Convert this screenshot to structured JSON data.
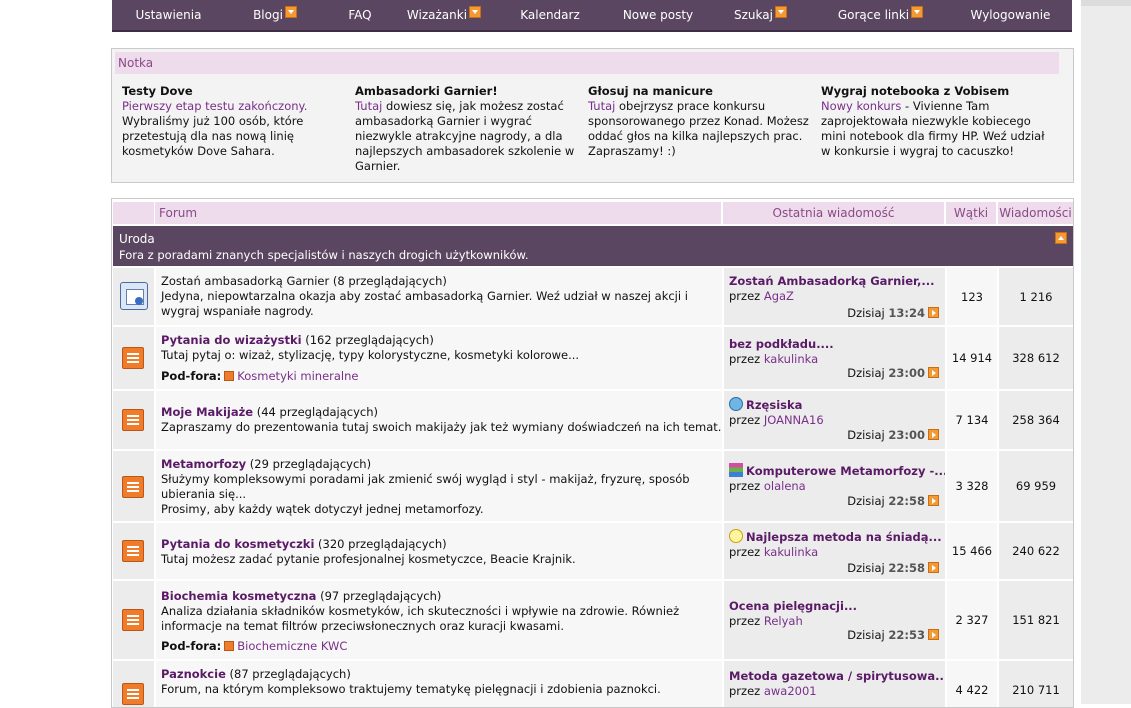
{
  "nav": [
    {
      "label": "Ustawienia",
      "dropdown": false
    },
    {
      "label": "Blogi",
      "dropdown": true
    },
    {
      "label": "FAQ",
      "dropdown": false
    },
    {
      "label": "Wizażanki",
      "dropdown": true
    },
    {
      "label": "Kalendarz",
      "dropdown": false
    },
    {
      "label": "Nowe posty",
      "dropdown": false
    },
    {
      "label": "Szukaj",
      "dropdown": true
    },
    {
      "label": "Gorące linki",
      "dropdown": true
    },
    {
      "label": "Wylogowanie",
      "dropdown": false
    }
  ],
  "notice": {
    "header": "Notka",
    "columns": [
      {
        "title": "Testy Dove",
        "link": "Pierwszy etap testu zakończony.",
        "text": " Wybraliśmy już 100 osób, które przetestują dla nas nową linię kosmetyków Dove Sahara."
      },
      {
        "title": "Ambasadorki Garnier!",
        "link": "Tutaj",
        "text": " dowiesz się, jak możesz zostać ambasadorką Garnier i wygrać niezwykle atrakcyjne nagrody, a dla najlepszych ambasadorek szkolenie w Garnier."
      },
      {
        "title": "Głosuj na manicure",
        "link": "Tutaj",
        "text": " obejrzysz prace konkursu sponsorowanego przez Konad. Możesz oddać głos na kilka najlepszych prac. Zapraszamy! :)"
      },
      {
        "title": "Wygraj notebooka z Vobisem",
        "link": "Nowy konkurs",
        "text": " - Vivienne Tam zaprojektowała niezwykle kobiecego mini notebook dla firmy HP. Weź udział w konkursie i wygraj to cacuszko!"
      }
    ]
  },
  "table": {
    "headers": {
      "forum": "Forum",
      "last": "Ostatnia wiadomość",
      "threads": "Wątki",
      "posts": "Wiadomości"
    },
    "category": {
      "name": "Uroda",
      "description": "Fora z poradami znanych specjalistów i naszych drogich użytkowników."
    },
    "rows": [
      {
        "title": "Zostań ambasadorką Garnier",
        "viewers": " (8 przeglądających)",
        "desc": "Jedyna, niepowtarzalna okazja aby zostać ambasadorką Garnier. Weź udział w naszej akcji i wygraj wspaniałe nagrody.",
        "subforum_label": "",
        "subforum": "",
        "last_title": "Zostań Ambasadorką Garnier,...",
        "last_icon": "",
        "last_by": "przez ",
        "last_user": "AgaZ",
        "last_day": "Dzisiaj ",
        "last_time": "13:24",
        "threads": "123",
        "posts": "1 216",
        "icon": "special-forum-icon"
      },
      {
        "title": "Pytania do wizażystki",
        "viewers": " (162 przeglądających)",
        "desc": "Tutaj pytaj o: wizaż, stylizację, typy kolorystyczne, kosmetyki kolorowe...",
        "subforum_label": "Pod-fora:",
        "subforum": "Kosmetyki mineralne",
        "last_title": "bez podkładu....",
        "last_icon": "",
        "last_by": "przez ",
        "last_user": "kakulinka",
        "last_day": "Dzisiaj ",
        "last_time": "23:00",
        "threads": "14 914",
        "posts": "328 612",
        "icon": "forum-icon"
      },
      {
        "title": "Moje Makijaże",
        "viewers": " (44 przeglądających)",
        "desc": "Zapraszamy do prezentowania tutaj swoich makijaży jak też wymiany doświadczeń na ich temat.",
        "subforum_label": "",
        "subforum": "",
        "last_title": "Rzęsiska",
        "last_icon": "smile",
        "last_by": "przez ",
        "last_user": "JOANNA16",
        "last_day": "Dzisiaj ",
        "last_time": "23:00",
        "threads": "7 134",
        "posts": "258 364",
        "icon": "forum-icon"
      },
      {
        "title": "Metamorfozy",
        "viewers": " (29 przeglądających)",
        "desc": "Służymy kompleksowymi poradami jak zmienić swój wygląd i styl - makijaż, fryzurę, sposób ubierania się...",
        "desc2": "Prosimy, aby każdy wątek dotyczył jednej metamorfozy.",
        "subforum_label": "",
        "subforum": "",
        "last_title": "Komputerowe Metamorfozy -...",
        "last_icon": "bars",
        "last_by": "przez ",
        "last_user": "olalena",
        "last_day": "Dzisiaj ",
        "last_time": "22:58",
        "threads": "3 328",
        "posts": "69 959",
        "icon": "forum-icon"
      },
      {
        "title": "Pytania do kosmetyczki",
        "viewers": " (320 przeglądających)",
        "desc": "Tutaj możesz zadać pytanie profesjonalnej kosmetyczce, Beacie Krajnik.",
        "subforum_label": "",
        "subforum": "",
        "last_title": "Najlepsza metoda na śniadą...",
        "last_icon": "bulb",
        "last_by": "przez ",
        "last_user": "kakulinka",
        "last_day": "Dzisiaj ",
        "last_time": "22:58",
        "threads": "15 466",
        "posts": "240 622",
        "icon": "forum-icon"
      },
      {
        "title": "Biochemia kosmetyczna",
        "viewers": " (97 przeglądających)",
        "desc": "Analiza działania składników kosmetyków, ich skuteczności i wpływie na zdrowie. Również informacje na temat filtrów przeciwsłonecznych oraz kuracji kwasami.",
        "subforum_label": "Pod-fora:",
        "subforum": "Biochemiczne KWC",
        "last_title": "Ocena pielęgnacji...",
        "last_icon": "",
        "last_by": "przez ",
        "last_user": "Relyah",
        "last_day": "Dzisiaj ",
        "last_time": "22:53",
        "threads": "2 327",
        "posts": "151 821",
        "icon": "forum-icon"
      },
      {
        "title": "Paznokcie",
        "viewers": " (87 przeglądających)",
        "desc": "Forum, na którym kompleksowo traktujemy tematykę pielęgnacji i zdobienia paznokci.",
        "subforum_label": "",
        "subforum": "",
        "last_title": "Metoda gazetowa / spirytusowa...",
        "last_icon": "",
        "last_by": "przez ",
        "last_user": "awa2001",
        "last_day": "",
        "last_time": "",
        "threads": "4 422",
        "posts": "210 711",
        "icon": "forum-icon"
      }
    ]
  }
}
